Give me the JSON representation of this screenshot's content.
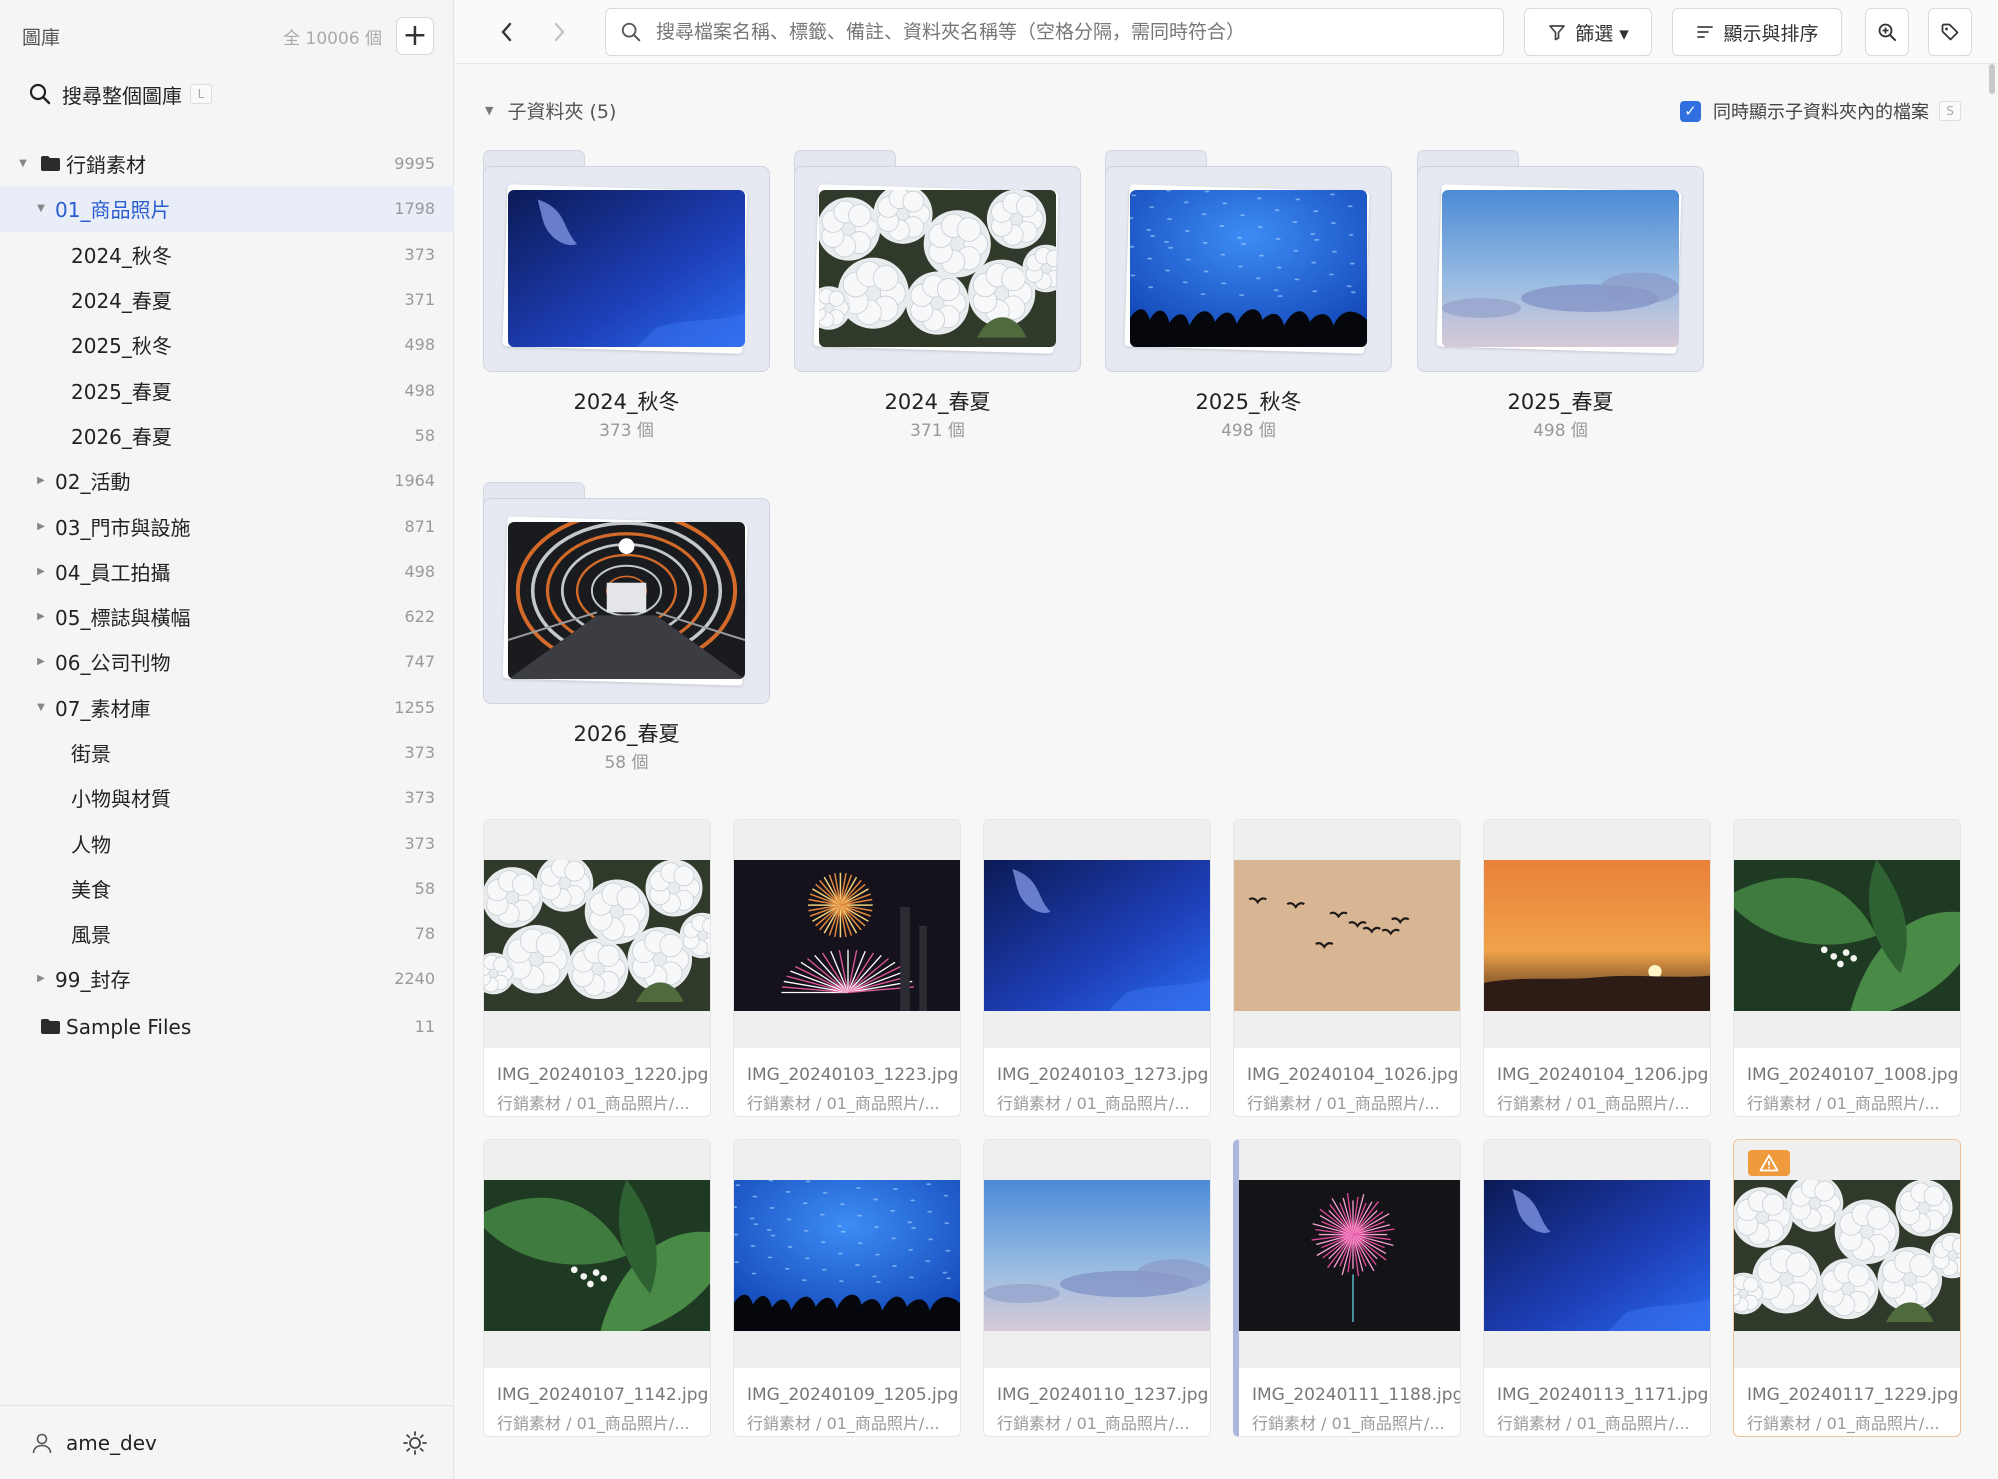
{
  "sidebar": {
    "title": "圖庫",
    "total": "全 10006 個",
    "search_label": "搜尋整個圖庫",
    "search_shortcut": "L",
    "tree": [
      {
        "label": "行銷素材",
        "count": "9995",
        "level": 0,
        "expanded": true,
        "folder_icon": true
      },
      {
        "label": "01_商品照片",
        "count": "1798",
        "level": 1,
        "expanded": true,
        "selected": true
      },
      {
        "label": "2024_秋冬",
        "count": "373",
        "level": 2
      },
      {
        "label": "2024_春夏",
        "count": "371",
        "level": 2
      },
      {
        "label": "2025_秋冬",
        "count": "498",
        "level": 2
      },
      {
        "label": "2025_春夏",
        "count": "498",
        "level": 2
      },
      {
        "label": "2026_春夏",
        "count": "58",
        "level": 2
      },
      {
        "label": "02_活動",
        "count": "1964",
        "level": 1,
        "expanded": false
      },
      {
        "label": "03_門市與設施",
        "count": "871",
        "level": 1,
        "expanded": false
      },
      {
        "label": "04_員工拍攝",
        "count": "498",
        "level": 1,
        "expanded": false
      },
      {
        "label": "05_標誌與橫幅",
        "count": "622",
        "level": 1,
        "expanded": false
      },
      {
        "label": "06_公司刊物",
        "count": "747",
        "level": 1,
        "expanded": false
      },
      {
        "label": "07_素材庫",
        "count": "1255",
        "level": 1,
        "expanded": true
      },
      {
        "label": "街景",
        "count": "373",
        "level": 2
      },
      {
        "label": "小物與材質",
        "count": "373",
        "level": 2
      },
      {
        "label": "人物",
        "count": "373",
        "level": 2
      },
      {
        "label": "美食",
        "count": "58",
        "level": 2
      },
      {
        "label": "風景",
        "count": "78",
        "level": 2
      },
      {
        "label": "99_封存",
        "count": "2240",
        "level": 1,
        "expanded": false
      },
      {
        "label": "Sample Files",
        "count": "11",
        "level": 0,
        "folder_icon": true
      }
    ],
    "user": "ame_dev"
  },
  "toolbar": {
    "search_placeholder": "搜尋檔案名稱、標籤、備註、資料夾名稱等（空格分隔，需同時符合）",
    "filter_label": "篩選 ▾",
    "sort_label": "顯示與排序"
  },
  "subfolders": {
    "header": "子資料夾 (5)",
    "show_sub_files": "同時顯示子資料夾內的檔案",
    "show_sub_shortcut": "S",
    "items": [
      {
        "name": "2024_秋冬",
        "count": "373 個",
        "thumb": "bluesky"
      },
      {
        "name": "2024_春夏",
        "count": "371 個",
        "thumb": "flowers"
      },
      {
        "name": "2025_秋冬",
        "count": "498 個",
        "thumb": "aquarium"
      },
      {
        "name": "2025_春夏",
        "count": "498 個",
        "thumb": "clouds"
      },
      {
        "name": "2026_春夏",
        "count": "58 個",
        "thumb": "tunnel"
      }
    ]
  },
  "files": [
    {
      "name": "IMG_20240103_1220.jpg",
      "path": "行銷素材 / 01_商品照片/...",
      "thumb": "flowers"
    },
    {
      "name": "IMG_20240103_1223.jpg",
      "path": "行銷素材 / 01_商品照片/...",
      "thumb": "fireworks-red"
    },
    {
      "name": "IMG_20240103_1273.jpg",
      "path": "行銷素材 / 01_商品照片/...",
      "thumb": "bluesky"
    },
    {
      "name": "IMG_20240104_1026.jpg",
      "path": "行銷素材 / 01_商品照片/...",
      "thumb": "birds"
    },
    {
      "name": "IMG_20240104_1206.jpg",
      "path": "行銷素材 / 01_商品照片/...",
      "thumb": "sunset"
    },
    {
      "name": "IMG_20240107_1008.jpg",
      "path": "行銷素材 / 01_商品照片/...",
      "thumb": "leaves"
    },
    {
      "name": "IMG_20240107_1142.jpg",
      "path": "行銷素材 / 01_商品照片/...",
      "thumb": "leaves"
    },
    {
      "name": "IMG_20240109_1205.jpg",
      "path": "行銷素材 / 01_商品照片/...",
      "thumb": "aquarium"
    },
    {
      "name": "IMG_20240110_1237.jpg",
      "path": "行銷素材 / 01_商品照片/...",
      "thumb": "clouds"
    },
    {
      "name": "IMG_20240111_1188.jpg",
      "path": "行銷素材 / 01_商品照片/...",
      "thumb": "fireworks-pink"
    },
    {
      "name": "IMG_20240113_1171.jpg",
      "path": "行銷素材 / 01_商品照片/...",
      "thumb": "bluesky"
    },
    {
      "name": "IMG_20240117_1229.jpg",
      "path": "行銷素材 / 01_商品照片/...",
      "thumb": "flowers",
      "warning": true
    }
  ],
  "colors": {
    "accent": "#2f6fe0",
    "selected_bg": "#e8edf7",
    "warning": "#ef9a3c"
  }
}
